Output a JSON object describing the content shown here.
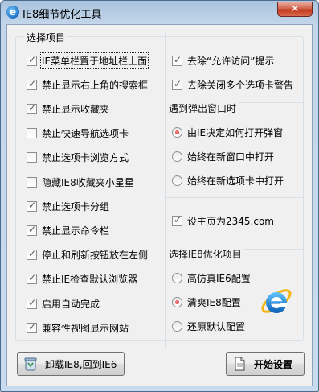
{
  "window": {
    "title": "IE8细节优化工具",
    "close_label": "✕"
  },
  "left_group": {
    "title": "选择项目",
    "items": [
      {
        "label": "IE菜单栏置于地址栏上面",
        "checked": true
      },
      {
        "label": "禁止显示右上角的搜索框",
        "checked": true
      },
      {
        "label": "禁止显示收藏夹",
        "checked": true
      },
      {
        "label": "禁止快速导航选项卡",
        "checked": false
      },
      {
        "label": "禁止选项卡浏览方式",
        "checked": false
      },
      {
        "label": "隐藏IE8收藏夹小星星",
        "checked": false
      },
      {
        "label": "禁止选项卡分组",
        "checked": true
      },
      {
        "label": "禁止显示命令栏",
        "checked": true
      },
      {
        "label": "停止和刷新按钮放在左侧",
        "checked": true
      },
      {
        "label": "禁止IE检查默认浏览器",
        "checked": true
      },
      {
        "label": "启用自动完成",
        "checked": true
      },
      {
        "label": "兼容性视图显示网站",
        "checked": true
      }
    ]
  },
  "right_top": {
    "items": [
      {
        "label": "去除“允许访问”提示",
        "checked": true
      },
      {
        "label": "去除关闭多个选项卡警告",
        "checked": true
      }
    ]
  },
  "popup_group": {
    "title": "遇到弹出窗口时",
    "options": [
      {
        "label": "由IE决定如何打开弹窗",
        "selected": true
      },
      {
        "label": "始终在新窗口中打开",
        "selected": false
      },
      {
        "label": "始终在新选项卡中打开",
        "selected": false
      }
    ]
  },
  "homepage": {
    "label": "设主页为2345.com",
    "checked": true
  },
  "optimize_group": {
    "title": "选择IE8优化项目",
    "options": [
      {
        "label": "高仿真IE6配置",
        "selected": false
      },
      {
        "label": "清爽IE8配置",
        "selected": true
      },
      {
        "label": "还原默认配置",
        "selected": false
      }
    ]
  },
  "buttons": {
    "uninstall_label": "卸载IE8,回到IE6",
    "start_label": "开始设置"
  },
  "icons": {
    "app": "ie-icon",
    "uninstall": "recycle-bin-icon",
    "start": "document-icon",
    "logo": "ie-logo-icon"
  },
  "colors": {
    "title_bar": "#c3d6ea",
    "close_button": "#c2391f",
    "panel": "#f0f0f0",
    "radio_dot": "#c21a1a"
  }
}
